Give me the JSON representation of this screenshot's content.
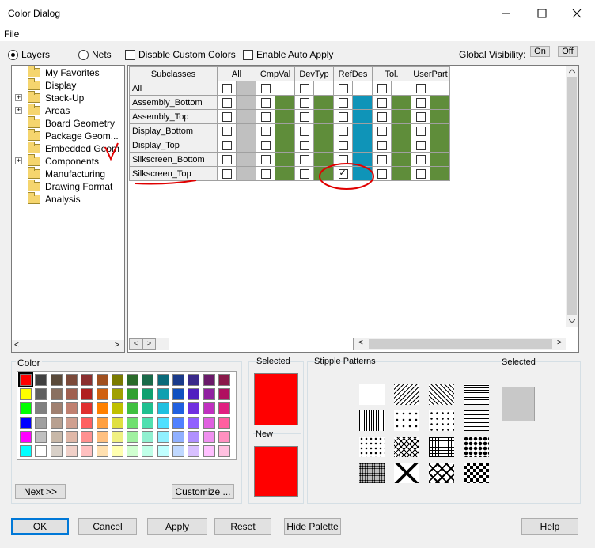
{
  "window": {
    "title": "Color Dialog",
    "menu": [
      "File"
    ]
  },
  "top_controls": {
    "layers_label": "Layers",
    "nets_label": "Nets",
    "disable_custom_colors": "Disable Custom Colors",
    "enable_auto_apply": "Enable Auto Apply",
    "global_visibility": "Global Visibility:",
    "on": "On",
    "off": "Off"
  },
  "tree": [
    {
      "label": "My Favorites",
      "expandable": false
    },
    {
      "label": "Display",
      "expandable": false
    },
    {
      "label": "Stack-Up",
      "expandable": true
    },
    {
      "label": "Areas",
      "expandable": true
    },
    {
      "label": "Board Geometry",
      "expandable": false
    },
    {
      "label": "Package Geom...",
      "expandable": false
    },
    {
      "label": "Embedded Geom",
      "expandable": false
    },
    {
      "label": "Components",
      "expandable": true
    },
    {
      "label": "Manufacturing",
      "expandable": false
    },
    {
      "label": "Drawing Format",
      "expandable": false
    },
    {
      "label": "Analysis",
      "expandable": false
    }
  ],
  "grid": {
    "headers": [
      "Subclasses",
      "All",
      "CmpVal",
      "DevTyp",
      "RefDes",
      "Tol.",
      "UserPart"
    ],
    "rows": [
      "All",
      "Assembly_Bottom",
      "Assembly_Top",
      "Display_Bottom",
      "Display_Top",
      "Silkscreen_Bottom",
      "Silkscreen_Top"
    ],
    "column_colors": [
      "#c0c0c0",
      "#5f8d3a",
      "#5f8d3a",
      "#0f94b8",
      "#5f8d3a",
      "#5f8d3a"
    ],
    "checked": [
      {
        "row": "Silkscreen_Top",
        "col": "RefDes"
      }
    ]
  },
  "palette": {
    "label": "Color",
    "rows": [
      [
        "#ff0000",
        "#404040",
        "#5a4a3a",
        "#7b4a3a",
        "#8b3030",
        "#a05020",
        "#7a7a00",
        "#2a6a2a",
        "#1a6a4a",
        "#0a6a7a",
        "#1a3a8a",
        "#3a2a8a",
        "#6a1a6a",
        "#8a1a4a"
      ],
      [
        "#ffff00",
        "#606060",
        "#8a7060",
        "#a06050",
        "#b02020",
        "#d06010",
        "#a0a000",
        "#30a030",
        "#10a070",
        "#10a0b0",
        "#1050c0",
        "#5020c0",
        "#9020a0",
        "#b01060"
      ],
      [
        "#00ff00",
        "#808080",
        "#a08070",
        "#c08070",
        "#e03030",
        "#ff8000",
        "#c0c000",
        "#40c040",
        "#20c090",
        "#20c0e0",
        "#2060e0",
        "#7030e0",
        "#c030c0",
        "#e02080"
      ],
      [
        "#0000ff",
        "#a0a0a0",
        "#b8a090",
        "#d0a090",
        "#ff6060",
        "#ffa040",
        "#e0e040",
        "#70e070",
        "#50e0b0",
        "#50e0ff",
        "#5080ff",
        "#9060ff",
        "#e060e0",
        "#ff60a0"
      ],
      [
        "#ff00ff",
        "#c0c0c0",
        "#c8b8a8",
        "#e0b8a8",
        "#ff9090",
        "#ffc080",
        "#f0f080",
        "#a0f0a0",
        "#90f0d0",
        "#90f0ff",
        "#90b0ff",
        "#b090ff",
        "#f090f0",
        "#ff90c0"
      ],
      [
        "#00ffff",
        "#ffffff",
        "#d8d0c8",
        "#f0d0c8",
        "#ffc0c0",
        "#ffe0b0",
        "#ffffb0",
        "#d0ffd0",
        "#c0ffe8",
        "#c0ffff",
        "#c0d8ff",
        "#d8c0ff",
        "#ffc0ff",
        "#ffc0e0"
      ]
    ],
    "next": "Next >>",
    "customize": "Customize ..."
  },
  "selected_panel": {
    "selected_label": "Selected",
    "new_label": "New",
    "selected_color": "#ff0000",
    "new_color": "#ff0000"
  },
  "stipple": {
    "label": "Stipple Patterns",
    "selected_label": "Selected",
    "selected_color": "#c8c8c8"
  },
  "buttons": {
    "ok": "OK",
    "cancel": "Cancel",
    "apply": "Apply",
    "reset": "Reset",
    "hide_palette": "Hide Palette",
    "help": "Help"
  }
}
